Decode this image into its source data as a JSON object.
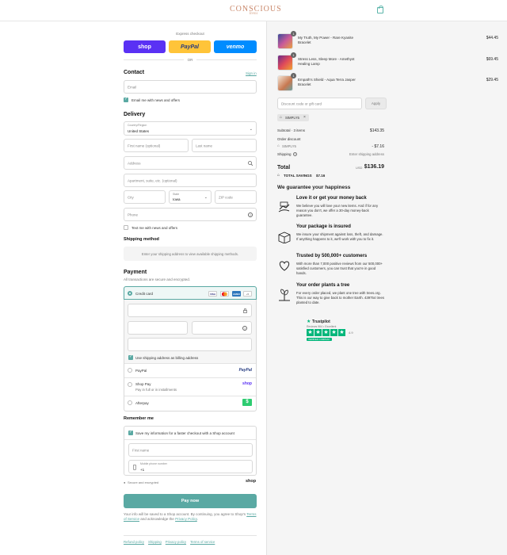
{
  "header": {
    "logo_main": "CONSCIOUS",
    "logo_sub": "Items"
  },
  "express": {
    "title": "Express checkout",
    "shop_label": "shop",
    "paypal_label": "PayPal",
    "venmo_label": "venmo",
    "or_label": "OR"
  },
  "contact": {
    "title": "Contact",
    "signin": "Sign in",
    "email_placeholder": "Email",
    "news_label": "Email me with news and offers"
  },
  "delivery": {
    "title": "Delivery",
    "country_label": "Country/Region",
    "country_value": "United States",
    "first_name": "First name (optional)",
    "last_name": "Last name",
    "address": "Address",
    "apartment": "Apartment, suite, etc. (optional)",
    "city": "City",
    "state_label": "State",
    "state_value": "Iowa",
    "zip": "ZIP code",
    "phone": "Phone",
    "text_label": "Text me with news and offers"
  },
  "shipping": {
    "title": "Shipping method",
    "message": "Enter your shipping address to view available shipping methods."
  },
  "payment": {
    "title": "Payment",
    "subtitle": "All transactions are secure and encrypted.",
    "credit_card": "Credit card",
    "more_cards": "+5",
    "billing_label": "Use shipping address as billing address",
    "paypal": "PayPal",
    "paypal_logo": "PayPal",
    "shoppay": "Shop Pay",
    "shoppay_sub": "Pay in full or in installments",
    "shoppay_logo": "shop",
    "afterpay": "Afterpay",
    "afterpay_logo": "$"
  },
  "remember": {
    "title": "Remember me",
    "save_label": "Save my information for a faster checkout with a Shop account",
    "first_name": "First name",
    "mobile_label": "Mobile phone number",
    "mobile_value": "+1",
    "secure_label": "Secure and encrypted",
    "shop_logo": "shop"
  },
  "pay_button": "Pay now",
  "legal": {
    "text1": "Your info will be saved to a Shop account. By continuing, you agree to Shop's",
    "terms": "Terms of Service",
    "text2": "and acknowledge the",
    "privacy": "Privacy Policy",
    "dot": "."
  },
  "footer": {
    "links": [
      "Refund policy",
      "Shipping",
      "Privacy policy",
      "Terms of service"
    ]
  },
  "cart": {
    "items": [
      {
        "name": "My Truth, My Power - Rare Kyanite Bracelet",
        "price": "$44.45",
        "qty": "1"
      },
      {
        "name": "Stress Less, Sleep More - Amethyst Healing Lamp",
        "price": "$69.45",
        "qty": "1"
      },
      {
        "name": "Empath's Shield - Aqua Terra Jasper Bracelet",
        "price": "$29.45",
        "qty": "1"
      }
    ],
    "discount_placeholder": "Discount code or gift card",
    "apply": "Apply",
    "code_tag": "SIMPLY5",
    "subtotal_label": "Subtotal · 3 items",
    "subtotal_value": "$143.35",
    "order_discount_label": "Order discount",
    "discount_code": "SIMPLY5",
    "discount_value": "- $7.16",
    "shipping_label": "Shipping",
    "shipping_value": "Enter shipping address",
    "total_label": "Total",
    "currency": "USD",
    "total_value": "$136.19",
    "savings_label": "TOTAL SAVINGS",
    "savings_value": "$7.16"
  },
  "guarantee": {
    "title": "We guarantee your happiness",
    "items": [
      {
        "title": "Love it or get your money back",
        "text": "We believe you will love your new items. And if for any reason you don't, we offer a 30-day money-back guarantee."
      },
      {
        "title": "Your package is insured",
        "text": "We insure your shipment against loss, theft, and damage. If anything happens to it, we'll work with you to fix it."
      },
      {
        "title": "Trusted by 500,000+ customers",
        "text": "With more than 7,000 positive reviews from our 500,000+ satisfied customers, you can trust that you're in good hands."
      },
      {
        "title": "Your order plants a tree",
        "text": "For every order placed, we plant one tree with trees.org. This is our way to give back to mother Earth. 439754 trees planted to date."
      }
    ],
    "trustpilot": "Trustpilot",
    "trust_reviews": "Reviews 964 • Excellent",
    "trust_score": "4.9",
    "trust_badge": "VERIFIED COMPANY"
  },
  "colors": {
    "accent": "#5aa9a3",
    "shop": "#5a31f4",
    "paypal": "#ffc439",
    "venmo": "#008cff",
    "afterpay": "#2ecc71",
    "trustpilot": "#00b67a"
  }
}
